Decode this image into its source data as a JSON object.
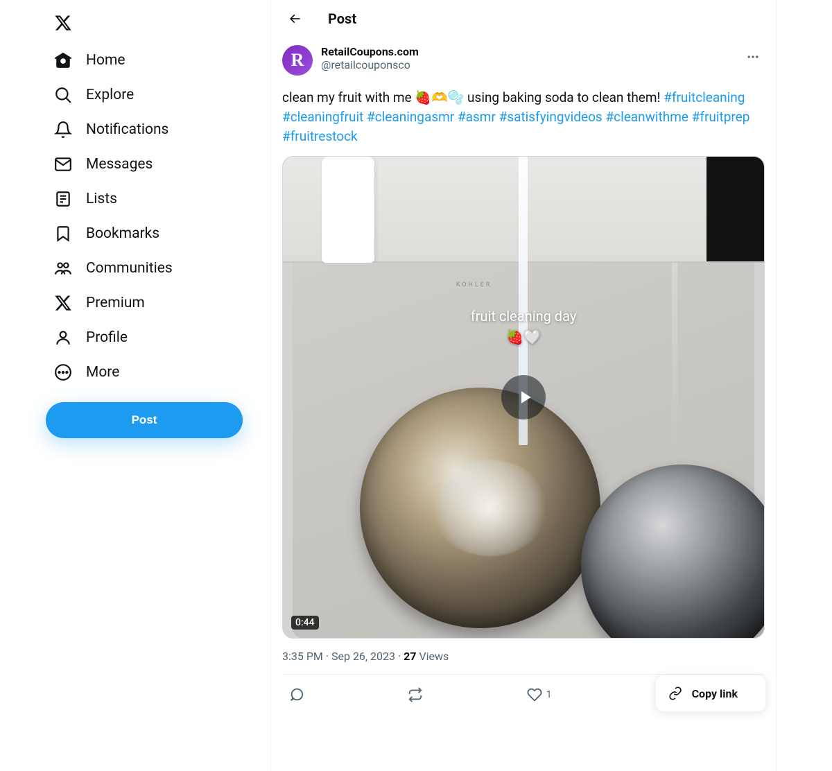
{
  "sidebar": {
    "items": [
      {
        "label": "Home"
      },
      {
        "label": "Explore"
      },
      {
        "label": "Notifications"
      },
      {
        "label": "Messages"
      },
      {
        "label": "Lists"
      },
      {
        "label": "Bookmarks"
      },
      {
        "label": "Communities"
      },
      {
        "label": "Premium"
      },
      {
        "label": "Profile"
      },
      {
        "label": "More"
      }
    ],
    "post_button": "Post"
  },
  "header": {
    "title": "Post"
  },
  "post": {
    "avatar_letter": "R",
    "display_name": "RetailCoupons.com",
    "handle": "@retailcouponsco",
    "text_before": "clean my fruit with me 🍓🫶🫧 using baking soda to clean them! ",
    "hashtags": [
      "#fruitcleaning",
      "#cleaningfruit",
      "#cleaningasmr",
      "#asmr",
      "#satisfyingvideos",
      "#cleanwithme",
      "#fruitprep",
      "#fruitrestock"
    ],
    "media": {
      "overlay_text": "fruit cleaning day",
      "overlay_emoji": "🍓🤍",
      "brand_text": "KOHLER",
      "duration": "0:44"
    },
    "timestamp": "3:35 PM · Sep 26, 2023",
    "views_count": "27",
    "views_label": " Views",
    "like_count": "1",
    "copy_link_label": "Copy link"
  }
}
